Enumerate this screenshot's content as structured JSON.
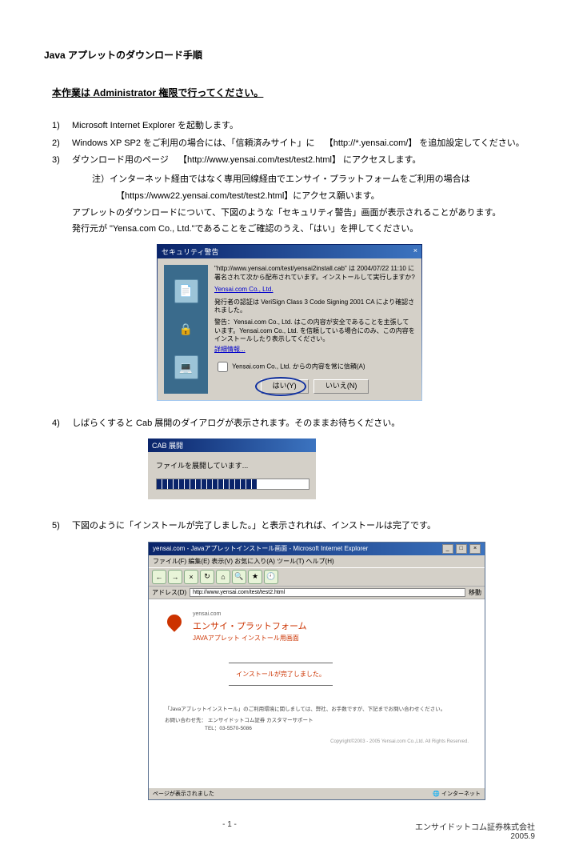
{
  "page": {
    "title": "Java アプレットのダウンロード手順",
    "admin_note": "本作業は Administrator 権限で行ってください。"
  },
  "steps": {
    "s1": {
      "num": "1)",
      "text": "Microsoft Internet Explorer を起動します。"
    },
    "s2": {
      "num": "2)",
      "text_a": "Windows XP SP2 をご利用の場合には、「信頼済みサイト」に",
      "text_b": "【http://*.yensai.com/】 を追加設定してください。"
    },
    "s3": {
      "num": "3)",
      "text_a": "ダウンロード用のページ",
      "text_b": "【http://www.yensai.com/test/test2.html】 にアクセスします。",
      "sub1": "注）インターネット経由ではなく専用回線経由でエンサイ・プラットフォームをご利用の場合は",
      "sub2": "【https://www22.yensai.com/test/test2.html】にアクセス願います。",
      "line3": "アプレットのダウンロードについて、下図のような「セキュリティ警告」画面が表示されることがあります。",
      "line4": "発行元が \"Yensa.com Co., Ltd.\"であることをご確認のうえ、「はい」を押してください。"
    },
    "s4": {
      "num": "4)",
      "text": "しばらくすると Cab 展開のダイアログが表示されます。そのままお待ちください。"
    },
    "s5": {
      "num": "5)",
      "text": "下図のように「インストールが完了しました。」と表示されれば、インストールは完了です。"
    }
  },
  "security_dialog": {
    "title": "セキュリティ警告",
    "close_x": "×",
    "text1": "\"http://www.yensai.com/test/yensai2install.cab\" は 2004/07/22 11:10 に署名されて次から配布されています。インストールして実行しますか?",
    "publisher": "Yensai.com Co., Ltd.",
    "text2": "発行者の認証は VeriSign Class 3 Code Signing 2001 CA により確認されました。",
    "text3": "警告：Yensai.com Co., Ltd. はこの内容が安全であることを主張しています。Yensai.com Co., Ltd. を信頼している場合にのみ、この内容をインストールしたり表示してください。",
    "more_link": "詳細情報...",
    "checkbox_label": "Yensai.com Co., Ltd. からの内容を常に信頼(A)",
    "btn_yes": "はい(Y)",
    "btn_no": "いいえ(N)"
  },
  "cab_dialog": {
    "title": "CAB 展開",
    "message": "ファイルを展開しています..."
  },
  "browser": {
    "window_title": "yensai.com - Javaアプレットインストール画面 - Microsoft Internet Explorer",
    "menu": "ファイル(F)  編集(E)  表示(V)  お気に入り(A)  ツール(T)  ヘルプ(H)",
    "address_label": "アドレス(D)",
    "address_value": "http://www.yensai.com/test/test2.html",
    "go": "移動",
    "sitename": "yensai.com",
    "page_heading": "エンサイ・プラットフォーム",
    "page_sub": "JAVAアプレット インストール用画面",
    "install_done": "インストールが完了しました。",
    "note1": "「Javaアプレットインストール」のご利用環境に関しましては、弊社、お手数ですが、下記までお問い合わせください。",
    "note2_label": "お問い合わせ先：",
    "note2_value": "エンサイドットコム証券  カスタマーサポート",
    "tel": "TEL：03-5570-5086",
    "copyright": "Copyright©2003 - 2005 Yensai.com Co.,Ltd. All Rights Reserved.",
    "status_left": "ページが表示されました",
    "status_right": "インターネット"
  },
  "footer": {
    "page_number": "- 1 -",
    "company": "エンサイドットコム証券株式会社",
    "date": "2005.9"
  }
}
